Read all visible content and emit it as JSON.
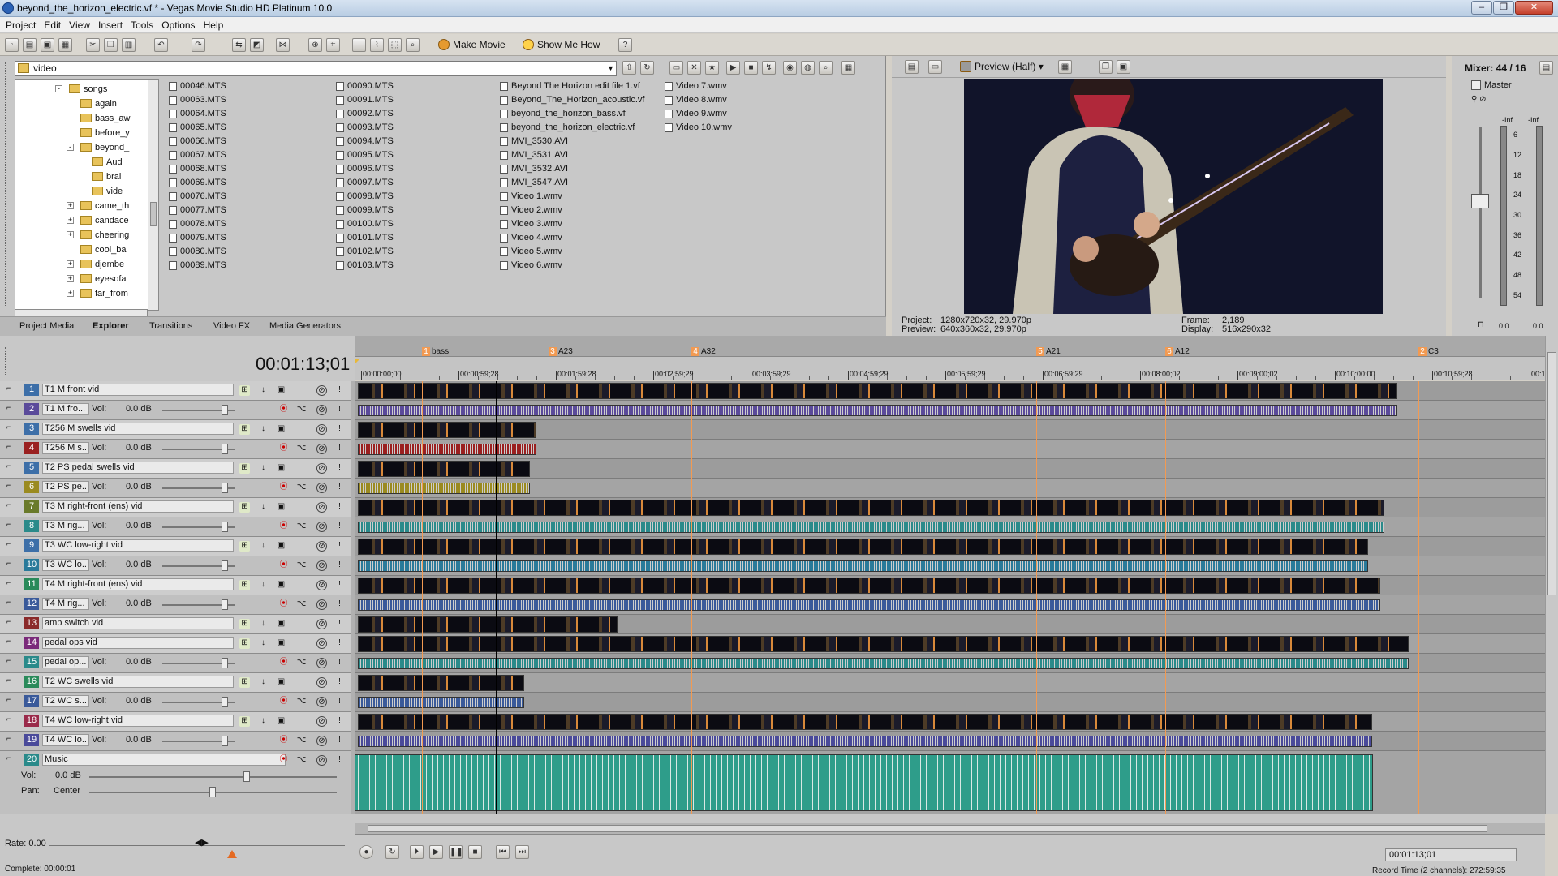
{
  "window": {
    "title": "beyond_the_horizon_electric.vf * - Vegas Movie Studio HD Platinum 10.0",
    "min": "–",
    "max": "❐",
    "close": "✕"
  },
  "menu": [
    "Project",
    "Edit",
    "View",
    "Insert",
    "Tools",
    "Options",
    "Help"
  ],
  "toolbar": {
    "make_movie": "Make Movie",
    "show_me_how": "Show Me How"
  },
  "explorer": {
    "path": "video",
    "tree": [
      {
        "label": "songs",
        "indent": 0,
        "pm": "-"
      },
      {
        "label": "again",
        "indent": 1,
        "pm": ""
      },
      {
        "label": "bass_aw",
        "indent": 1,
        "pm": ""
      },
      {
        "label": "before_y",
        "indent": 1,
        "pm": ""
      },
      {
        "label": "beyond_",
        "indent": 1,
        "pm": "-"
      },
      {
        "label": "Aud",
        "indent": 2,
        "pm": ""
      },
      {
        "label": "brai",
        "indent": 2,
        "pm": ""
      },
      {
        "label": "vide",
        "indent": 2,
        "pm": ""
      },
      {
        "label": "came_th",
        "indent": 1,
        "pm": "+"
      },
      {
        "label": "candace",
        "indent": 1,
        "pm": "+"
      },
      {
        "label": "cheering",
        "indent": 1,
        "pm": "+"
      },
      {
        "label": "cool_ba",
        "indent": 1,
        "pm": ""
      },
      {
        "label": "djembe",
        "indent": 1,
        "pm": "+"
      },
      {
        "label": "eyesofa",
        "indent": 1,
        "pm": "+"
      },
      {
        "label": "far_from",
        "indent": 1,
        "pm": "+"
      }
    ],
    "files": [
      [
        "00046.MTS",
        "00063.MTS",
        "00064.MTS",
        "00065.MTS",
        "00066.MTS",
        "00067.MTS",
        "00068.MTS",
        "00069.MTS",
        "00076.MTS",
        "00077.MTS",
        "00078.MTS",
        "00079.MTS",
        "00080.MTS",
        "00089.MTS"
      ],
      [
        "00090.MTS",
        "00091.MTS",
        "00092.MTS",
        "00093.MTS",
        "00094.MTS",
        "00095.MTS",
        "00096.MTS",
        "00097.MTS",
        "00098.MTS",
        "00099.MTS",
        "00100.MTS",
        "00101.MTS",
        "00102.MTS",
        "00103.MTS"
      ],
      [
        "Beyond The Horizon edit file 1.vf",
        "Beyond_The_Horizon_acoustic.vf",
        "beyond_the_horizon_bass.vf",
        "beyond_the_horizon_electric.vf",
        "MVI_3530.AVI",
        "MVI_3531.AVI",
        "MVI_3532.AVI",
        "MVI_3547.AVI",
        "Video 1.wmv",
        "Video 2.wmv",
        "Video 3.wmv",
        "Video 4.wmv",
        "Video 5.wmv",
        "Video 6.wmv"
      ],
      [
        "Video 7.wmv",
        "Video 8.wmv",
        "Video 9.wmv",
        "Video 10.wmv"
      ]
    ],
    "tabs": [
      "Project Media",
      "Explorer",
      "Transitions",
      "Video FX",
      "Media Generators"
    ],
    "active_tab": "Explorer"
  },
  "preview": {
    "mode": "Preview (Half)",
    "project_label": "Project:",
    "project_value": "1280x720x32, 29.970p",
    "preview_label": "Preview:",
    "preview_value": "640x360x32, 29.970p",
    "frame_label": "Frame:",
    "frame_value": "2,189",
    "display_label": "Display:",
    "display_value": "516x290x32"
  },
  "mixer": {
    "title": "Mixer: 44 / 16",
    "master": "Master",
    "inf_left": "-Inf.",
    "inf_right": "-Inf.",
    "scale": [
      "6",
      "12",
      "18",
      "24",
      "30",
      "36",
      "42",
      "48",
      "54"
    ],
    "out_left": "0.0",
    "out_right": "0.0"
  },
  "timeline": {
    "timecode": "00:01:13;01",
    "ruler_ticks": [
      "00:00:00;00",
      "00:00:59;28",
      "00:01:59;28",
      "00:02:59;29",
      "00:03:59;29",
      "00:04:59;29",
      "00:05:59;29",
      "00:06:59;29",
      "00:08:00;02",
      "00:09:00;02",
      "00:10:00;00",
      "00:10:59;28",
      "00:1"
    ],
    "markers": [
      {
        "num": "1",
        "label": "bass",
        "pos": 0.038
      },
      {
        "num": "3",
        "label": "A23",
        "pos": 0.11
      },
      {
        "num": "4",
        "label": "A32",
        "pos": 0.191
      },
      {
        "num": "5",
        "label": "A21",
        "pos": 0.387
      },
      {
        "num": "6",
        "label": "A12",
        "pos": 0.46
      },
      {
        "num": "2",
        "label": "C3",
        "pos": 0.604
      }
    ],
    "cursor_pos": 0.08,
    "vol_label": "Vol:",
    "tracks": [
      {
        "num": "1",
        "name": "T1 M front vid",
        "type": "video",
        "color": "#3d6fa8"
      },
      {
        "num": "2",
        "name": "T1 M fro...",
        "type": "audio",
        "vol": "0.0 dB",
        "color": "#5a4a9a"
      },
      {
        "num": "3",
        "name": "T256 M swells vid",
        "type": "video",
        "color": "#3d6fa8"
      },
      {
        "num": "4",
        "name": "T256 M s...",
        "type": "audio",
        "vol": "0.0 dB",
        "color": "#9a2020"
      },
      {
        "num": "5",
        "name": "T2 PS pedal swells vid",
        "type": "video",
        "color": "#3d6fa8"
      },
      {
        "num": "6",
        "name": "T2 PS pe...",
        "type": "audio",
        "vol": "0.0 dB",
        "color": "#9a8a20"
      },
      {
        "num": "7",
        "name": "T3 M right-front (ens) vid",
        "type": "video",
        "color": "#6a7a2a"
      },
      {
        "num": "8",
        "name": "T3 M rig...",
        "type": "audio",
        "vol": "0.0 dB",
        "color": "#2a8a8a"
      },
      {
        "num": "9",
        "name": "T3 WC low-right vid",
        "type": "video",
        "color": "#3d6fa8"
      },
      {
        "num": "10",
        "name": "T3 WC lo...",
        "type": "audio",
        "vol": "0.0 dB",
        "color": "#2a7a9a"
      },
      {
        "num": "11",
        "name": "T4 M right-front (ens) vid",
        "type": "video",
        "color": "#2a8a5a"
      },
      {
        "num": "12",
        "name": "T4 M rig...",
        "type": "audio",
        "vol": "0.0 dB",
        "color": "#3a5a9a"
      },
      {
        "num": "13",
        "name": "amp switch vid",
        "type": "video",
        "color": "#8a2a2a"
      },
      {
        "num": "14",
        "name": "pedal ops vid",
        "type": "video",
        "color": "#7a2a7a"
      },
      {
        "num": "15",
        "name": "pedal op...",
        "type": "audio",
        "vol": "0.0 dB",
        "color": "#2a8a8a"
      },
      {
        "num": "16",
        "name": "T2 WC swells vid",
        "type": "video",
        "color": "#2a8a5a"
      },
      {
        "num": "17",
        "name": "T2 WC s...",
        "type": "audio",
        "vol": "0.0 dB",
        "color": "#3a5a9a"
      },
      {
        "num": "18",
        "name": "T4 WC low-right vid",
        "type": "video",
        "color": "#9a2a4a"
      },
      {
        "num": "19",
        "name": "T4 WC lo...",
        "type": "audio",
        "vol": "0.0 dB",
        "color": "#4a4a9a"
      },
      {
        "num": "20",
        "name": "Music",
        "type": "music",
        "vol": "0.0 dB",
        "pan": "Center",
        "color": "#2a8a8a"
      }
    ],
    "pan_label": "Pan:",
    "rate": "Rate: 0.00",
    "status": "Complete: 00:00:01",
    "transport_time": "00:01:13;01",
    "record_time": "Record Time (2 channels): 272:59:35"
  },
  "colors": {
    "accent": "#f29a52",
    "video_clip": "#1a1a28",
    "music": "#2e9d8a"
  }
}
